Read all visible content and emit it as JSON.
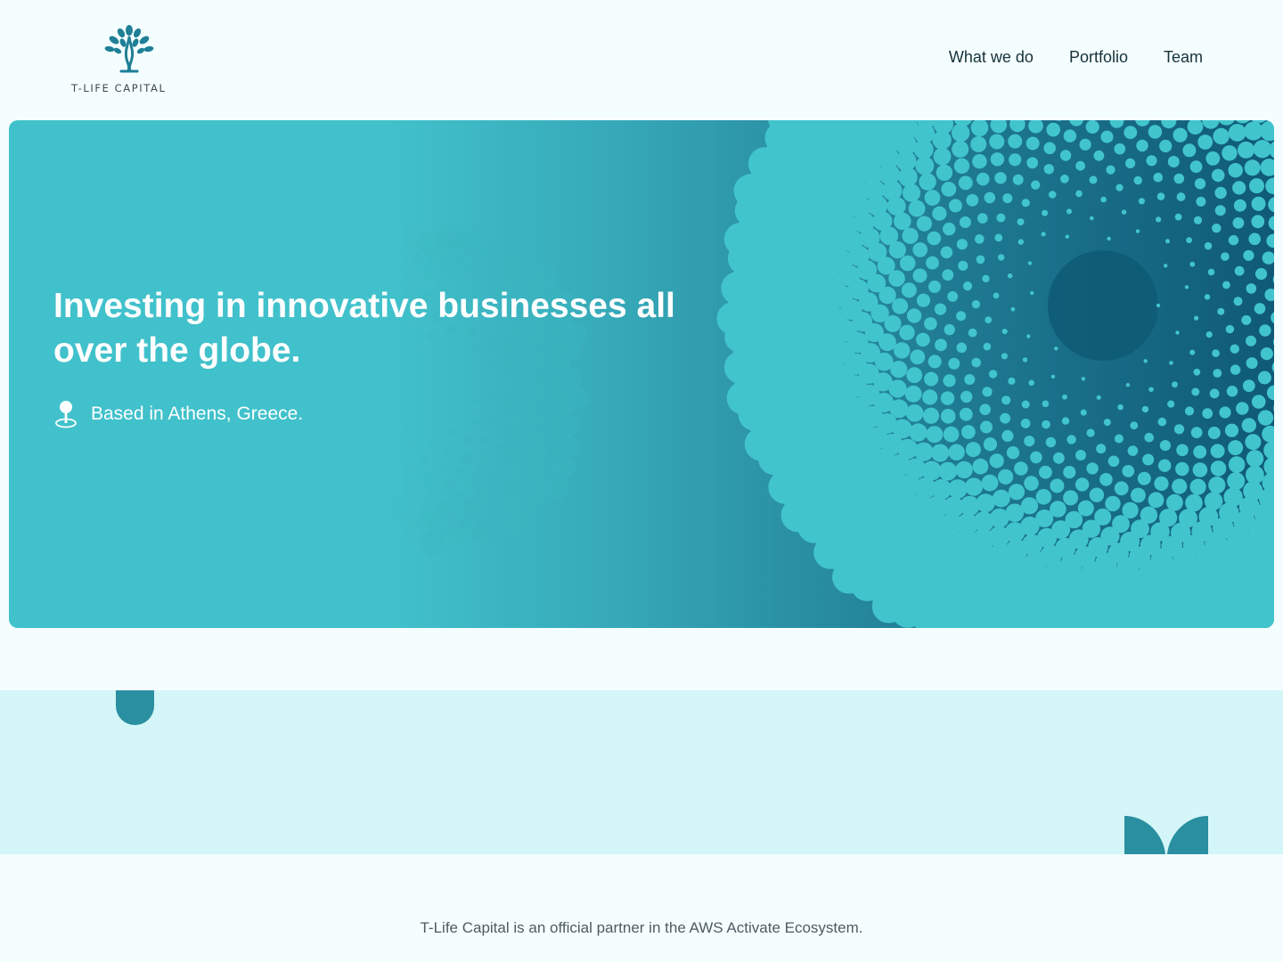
{
  "brand": {
    "name": "T-LIFE CAPITAL",
    "accent_color": "#2a8fa1",
    "logo_icon": "tree-icon"
  },
  "nav": {
    "items": [
      {
        "label": "What we do"
      },
      {
        "label": "Portfolio"
      },
      {
        "label": "Team"
      }
    ]
  },
  "hero": {
    "title": "Investing in innovative businesses all over the globe.",
    "location_icon": "location-pin-icon",
    "location": "Based in Athens, Greece.",
    "gradient_start": "#41c1cb",
    "gradient_end": "#0f5a77"
  },
  "band": {
    "color": "#d4f6f8"
  },
  "footer": {
    "text": "T-Life Capital is an official partner in the AWS Activate Ecosystem."
  }
}
